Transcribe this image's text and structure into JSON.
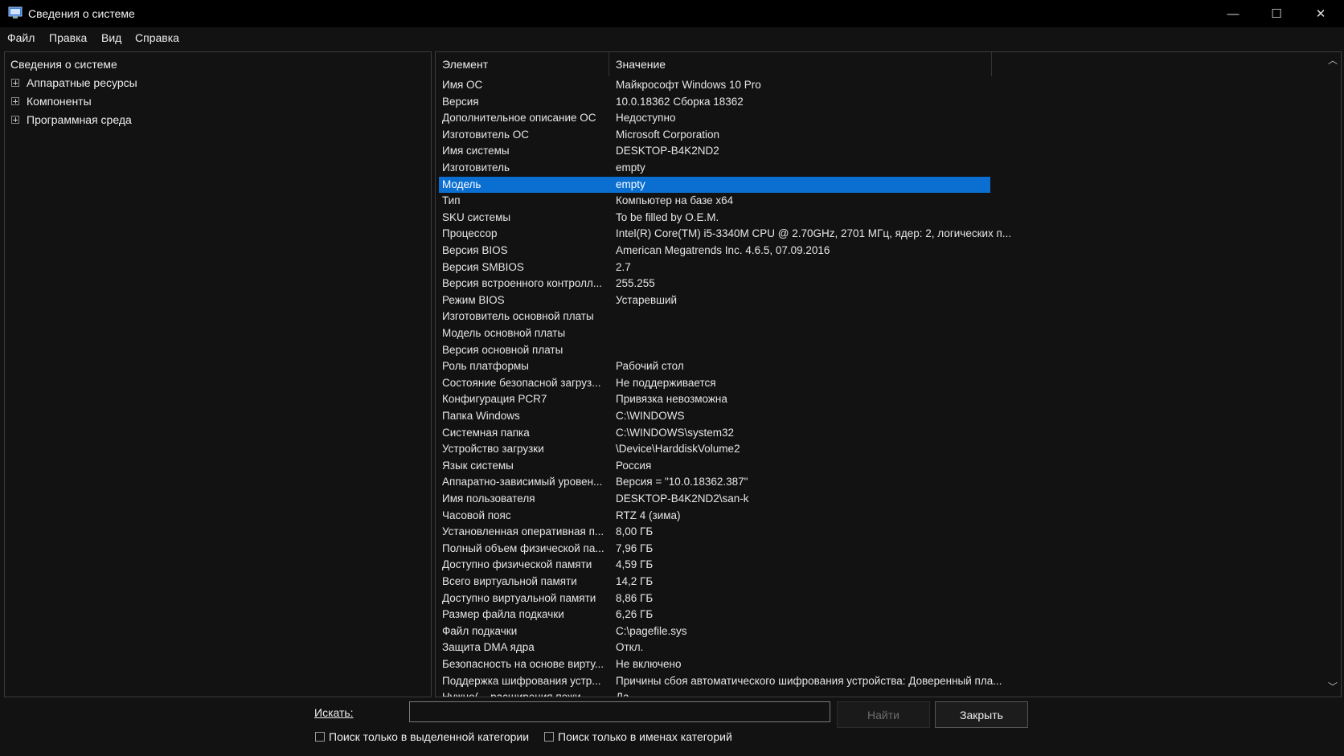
{
  "window": {
    "title": "Сведения о системе",
    "icon": "system-info-icon",
    "controls": {
      "minimize": "—",
      "maximize": "☐",
      "close": "✕"
    }
  },
  "menu": [
    "Файл",
    "Правка",
    "Вид",
    "Справка"
  ],
  "tree": {
    "root": "Сведения о системе",
    "items": [
      "Аппаратные ресурсы",
      "Компоненты",
      "Программная среда"
    ]
  },
  "list": {
    "headers": {
      "element": "Элемент",
      "value": "Значение"
    },
    "selected_index": 6,
    "rows": [
      {
        "k": "Имя ОС",
        "v": "Майкрософт Windows 10 Pro"
      },
      {
        "k": "Версия",
        "v": "10.0.18362 Сборка 18362"
      },
      {
        "k": "Дополнительное описание ОС",
        "v": "Недоступно"
      },
      {
        "k": "Изготовитель ОС",
        "v": "Microsoft Corporation"
      },
      {
        "k": "Имя системы",
        "v": "DESKTOP-B4K2ND2"
      },
      {
        "k": "Изготовитель",
        "v": "empty"
      },
      {
        "k": "Модель",
        "v": "empty"
      },
      {
        "k": "Тип",
        "v": "Компьютер на базе x64"
      },
      {
        "k": "SKU системы",
        "v": "To be filled by O.E.M."
      },
      {
        "k": "Процессор",
        "v": "Intel(R) Core(TM) i5-3340M CPU @ 2.70GHz, 2701 МГц, ядер: 2, логических п..."
      },
      {
        "k": "Версия BIOS",
        "v": "American Megatrends Inc. 4.6.5, 07.09.2016"
      },
      {
        "k": "Версия SMBIOS",
        "v": "2.7"
      },
      {
        "k": "Версия встроенного контролл...",
        "v": "255.255"
      },
      {
        "k": "Режим BIOS",
        "v": "Устаревший"
      },
      {
        "k": "Изготовитель основной платы",
        "v": ""
      },
      {
        "k": "Модель основной платы",
        "v": ""
      },
      {
        "k": "Версия основной платы",
        "v": ""
      },
      {
        "k": "Роль платформы",
        "v": "Рабочий стол"
      },
      {
        "k": "Состояние безопасной загруз...",
        "v": "Не поддерживается"
      },
      {
        "k": "Конфигурация PCR7",
        "v": "Привязка невозможна"
      },
      {
        "k": "Папка Windows",
        "v": "C:\\WINDOWS"
      },
      {
        "k": "Системная папка",
        "v": "C:\\WINDOWS\\system32"
      },
      {
        "k": "Устройство загрузки",
        "v": "\\Device\\HarddiskVolume2"
      },
      {
        "k": "Язык системы",
        "v": "Россия"
      },
      {
        "k": "Аппаратно-зависимый уровен...",
        "v": "Версия = \"10.0.18362.387\""
      },
      {
        "k": "Имя пользователя",
        "v": "DESKTOP-B4K2ND2\\san-k"
      },
      {
        "k": "Часовой пояс",
        "v": "RTZ 4 (зима)"
      },
      {
        "k": "Установленная оперативная п...",
        "v": "8,00 ГБ"
      },
      {
        "k": "Полный объем физической па...",
        "v": "7,96 ГБ"
      },
      {
        "k": "Доступно физической памяти",
        "v": "4,59 ГБ"
      },
      {
        "k": "Всего виртуальной памяти",
        "v": "14,2 ГБ"
      },
      {
        "k": "Доступно виртуальной памяти",
        "v": "8,86 ГБ"
      },
      {
        "k": "Размер файла подкачки",
        "v": "6,26 ГБ"
      },
      {
        "k": "Файл подкачки",
        "v": "C:\\pagefile.sys"
      },
      {
        "k": "Защита DMA ядра",
        "v": "Откл."
      },
      {
        "k": "Безопасность на основе вирту...",
        "v": "Не включено"
      },
      {
        "k": "Поддержка шифрования устр...",
        "v": "Причины сбоя автоматического шифрования устройства: Доверенный пла..."
      },
      {
        "k": "Нужно(... расширения пожи...",
        "v": "Да"
      }
    ]
  },
  "search": {
    "label": "Искать:",
    "value": "",
    "placeholder": "",
    "find_button": "Найти",
    "close_button": "Закрыть",
    "checkbox_selected_category": "Поиск только в выделенной категории",
    "checkbox_category_names": "Поиск только в именах категорий"
  },
  "colors": {
    "selection": "#0a6fd1",
    "background": "#121212",
    "titlebar": "#000000"
  }
}
